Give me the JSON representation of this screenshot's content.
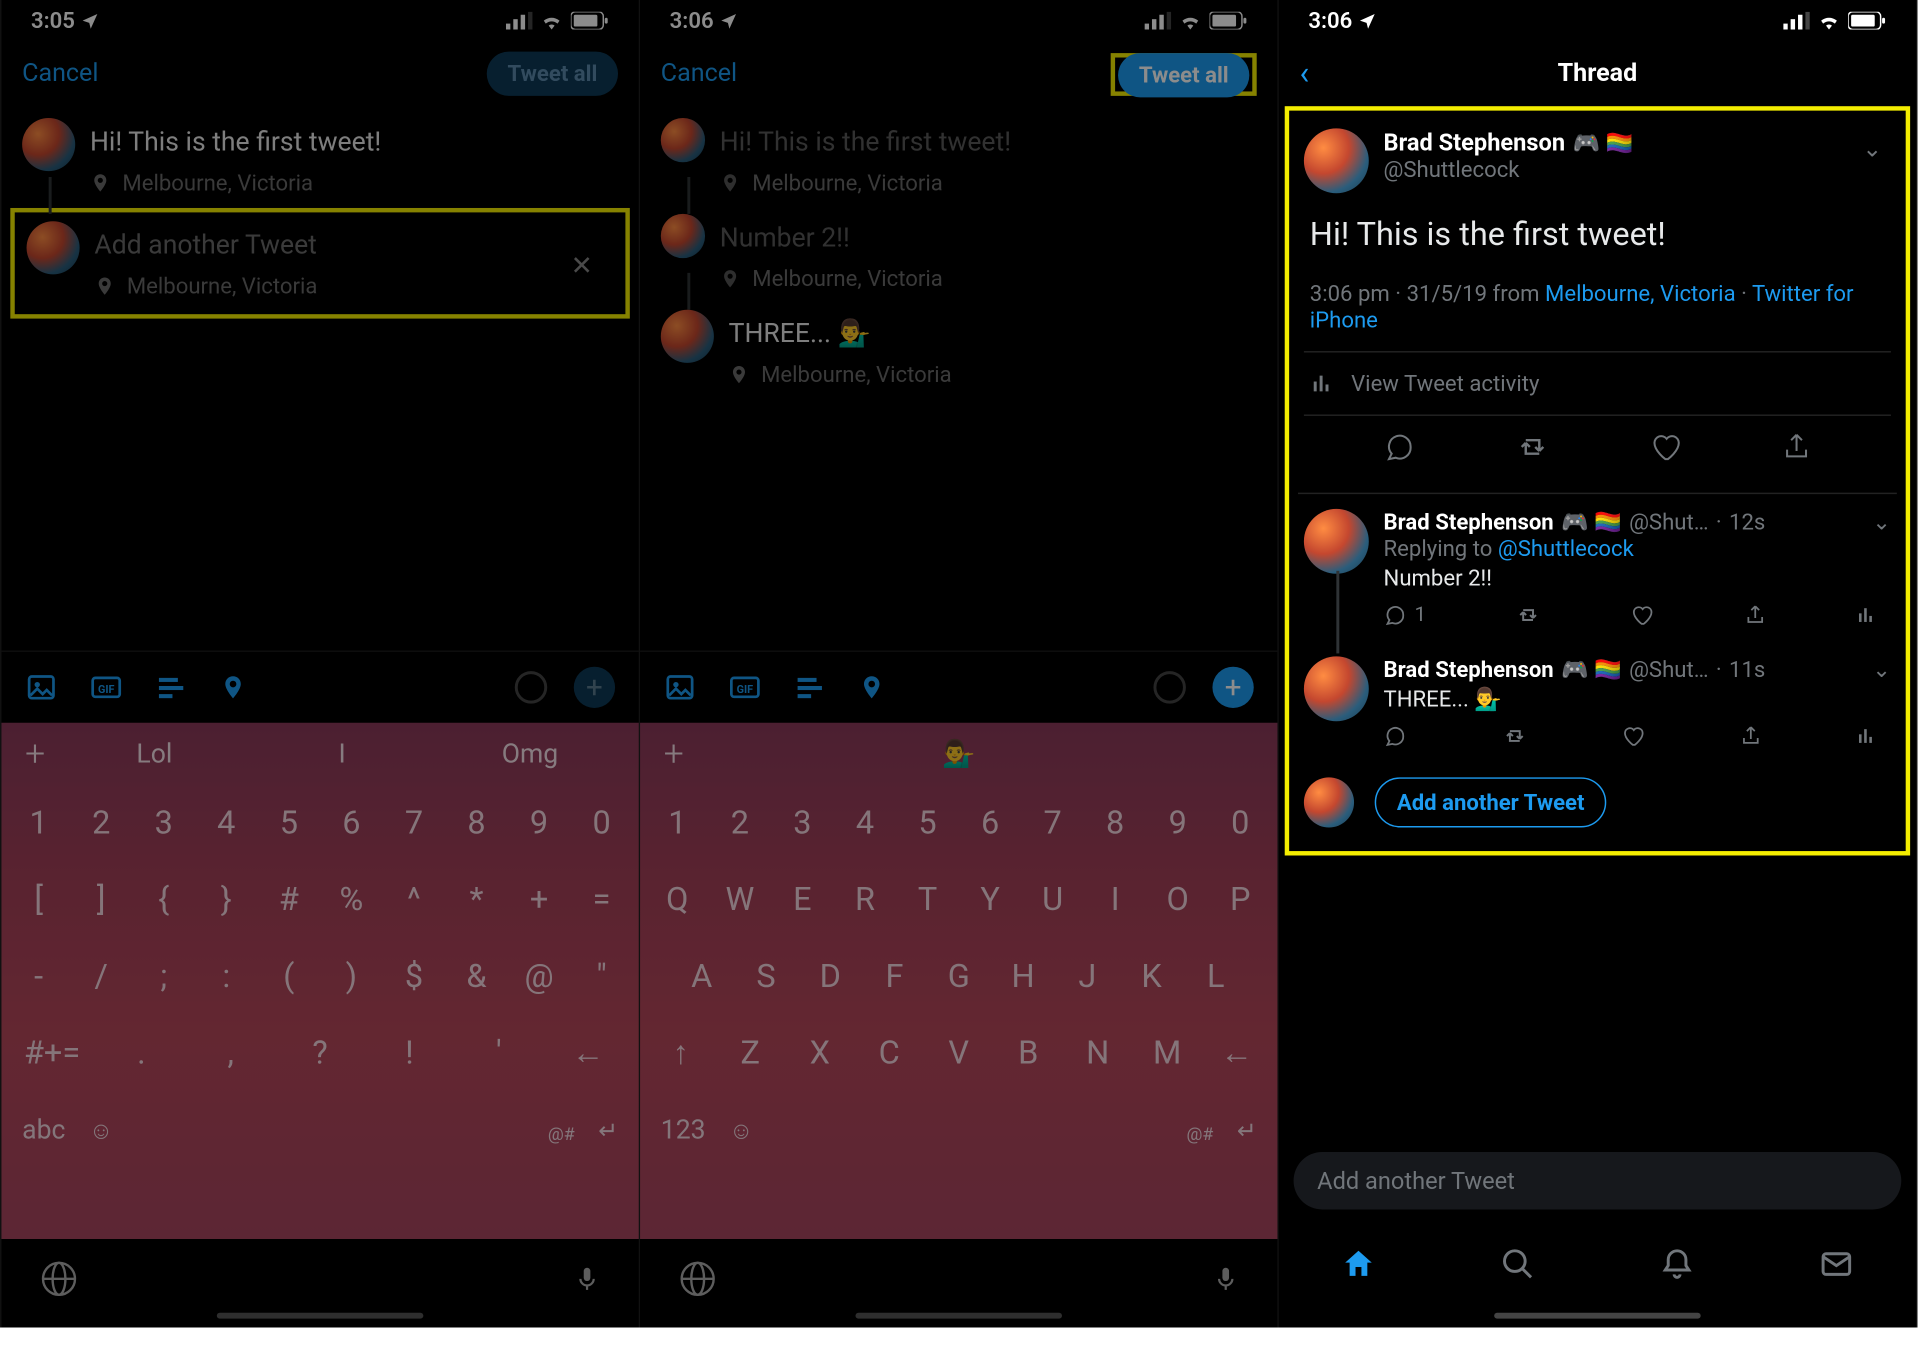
{
  "screen1": {
    "time": "3:05",
    "cancel": "Cancel",
    "tweet_all": "Tweet all",
    "tweet1": "Hi! This is the first tweet!",
    "location": "Melbourne, Victoria",
    "add_placeholder": "Add another Tweet",
    "sug1": "Lol",
    "sug2": "I",
    "sug3": "Omg",
    "kb_r1": [
      "1",
      "2",
      "3",
      "4",
      "5",
      "6",
      "7",
      "8",
      "9",
      "0"
    ],
    "kb_r2": [
      "[",
      "]",
      "{",
      "}",
      "#",
      "%",
      "^",
      "*",
      "+",
      "="
    ],
    "kb_r3": [
      "-",
      "/",
      ";",
      ":",
      "(",
      ")",
      "$",
      "&",
      "@",
      "\""
    ],
    "kb_r4": [
      "#+=",
      ".",
      ",",
      "?",
      "!",
      "'",
      "←"
    ],
    "kb_abc": "abc",
    "kb_at": "@#"
  },
  "screen2": {
    "time": "3:06",
    "cancel": "Cancel",
    "tweet_all": "Tweet all",
    "tweet1": "Hi! This is the first tweet!",
    "tweet2": "Number 2!!",
    "tweet3": "THREE... 💁‍♂️",
    "location": "Melbourne, Victoria",
    "sug_emoji": "💁‍♂️",
    "kb_r1": [
      "1",
      "2",
      "3",
      "4",
      "5",
      "6",
      "7",
      "8",
      "9",
      "0"
    ],
    "kb_r2": [
      "Q",
      "W",
      "E",
      "R",
      "T",
      "Y",
      "U",
      "I",
      "O",
      "P"
    ],
    "kb_r3": [
      "A",
      "S",
      "D",
      "F",
      "G",
      "H",
      "J",
      "K",
      "L"
    ],
    "kb_r4": [
      "↑",
      "Z",
      "X",
      "C",
      "V",
      "B",
      "N",
      "M",
      "←"
    ],
    "kb_123": "123",
    "kb_at": "@#"
  },
  "screen3": {
    "time": "3:06",
    "title": "Thread",
    "author": "Brad Stephenson",
    "author_emoji": "🎮 🏳️‍🌈",
    "handle": "@Shuttlecock",
    "main_text": "Hi! This is the first tweet!",
    "meta_time": "3:06 pm",
    "meta_date": "31/5/19",
    "meta_from": "from",
    "meta_loc": "Melbourne, Victoria",
    "meta_client": "Twitter for iPhone",
    "activity": "View Tweet activity",
    "reply1": {
      "name": "Brad Stephenson",
      "emoji": "🎮 🏳️‍🌈",
      "handle": "@Shut…",
      "time": "12s",
      "replying": "Replying to",
      "replyto": "@Shuttlecock",
      "text": "Number 2!!",
      "replies": "1"
    },
    "reply2": {
      "name": "Brad Stephenson",
      "emoji": "🎮 🏳️‍🌈",
      "handle": "@Shut…",
      "time": "11s",
      "text": "THREE... 💁‍♂️"
    },
    "add_another": "Add another Tweet",
    "reply_bar_placeholder": "Add another Tweet"
  }
}
